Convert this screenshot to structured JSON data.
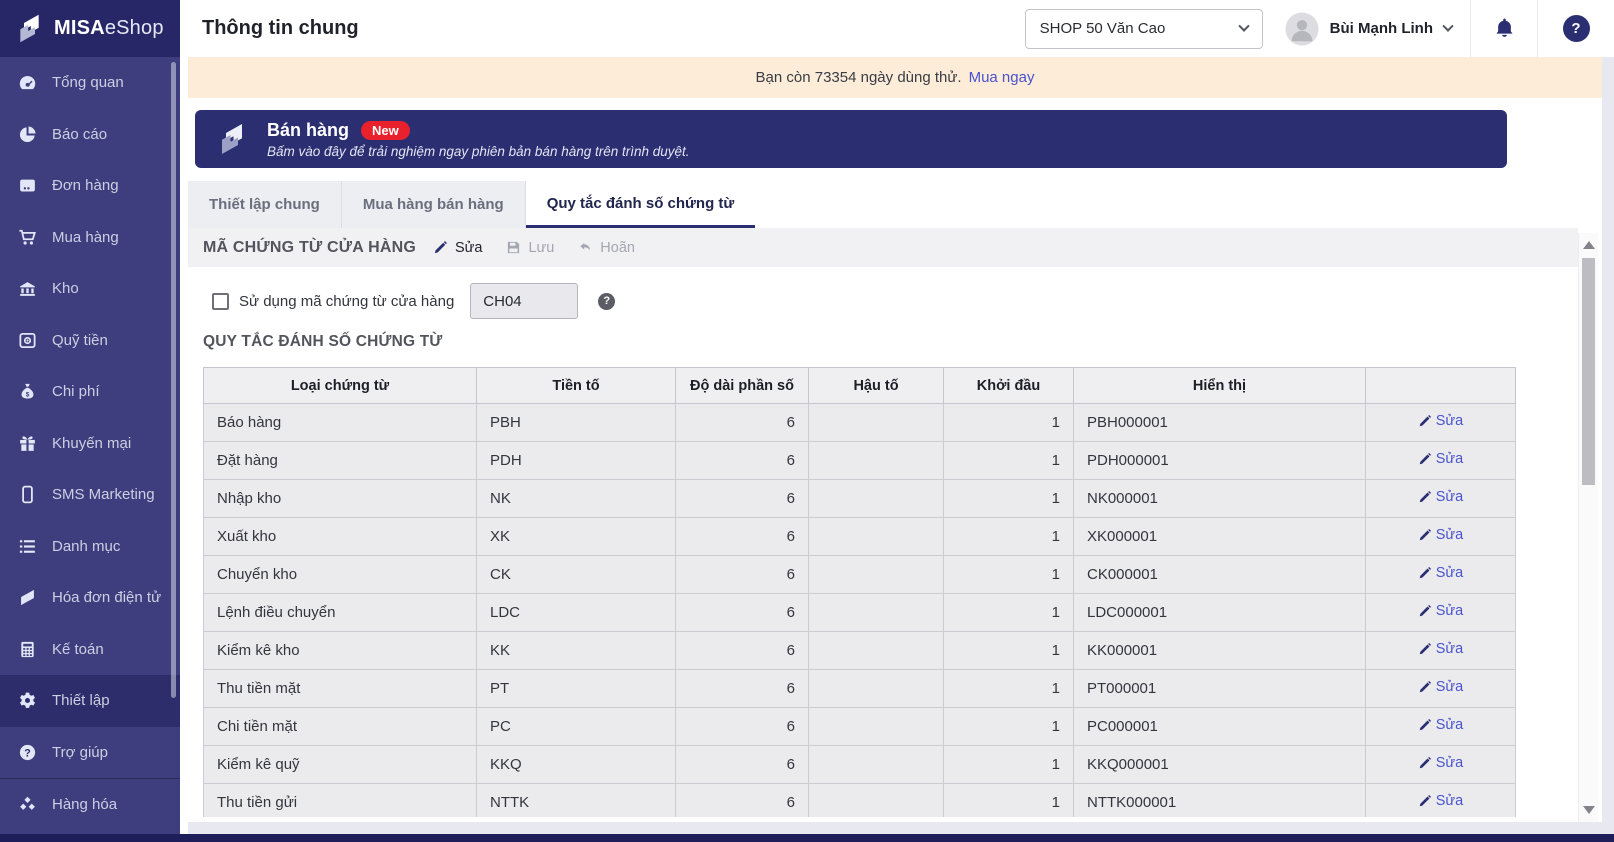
{
  "colors": {
    "accent_navy": "#2b2f72",
    "sidebar_bg": "#3e3e7e",
    "sidebar_header_bg": "#272768",
    "badge_red": "#e8212d",
    "link_blue": "#4a53cd",
    "trial_bg": "#fcecd8"
  },
  "brand": {
    "name_bold": "MISA",
    "name_rest": "eShop"
  },
  "sidebar": {
    "items": [
      {
        "id": "tong-quan",
        "icon": "dashboard",
        "label": "Tổng quan",
        "active": false
      },
      {
        "id": "bao-cao",
        "icon": "pie-chart",
        "label": "Báo cáo",
        "active": false
      },
      {
        "id": "don-hang",
        "icon": "orders",
        "label": "Đơn hàng",
        "active": false
      },
      {
        "id": "mua-hang",
        "icon": "cart",
        "label": "Mua hàng",
        "active": false
      },
      {
        "id": "kho",
        "icon": "warehouse",
        "label": "Kho",
        "active": false
      },
      {
        "id": "quy-tien",
        "icon": "safe",
        "label": "Quỹ tiền",
        "active": false
      },
      {
        "id": "chi-phi",
        "icon": "money-bag",
        "label": "Chi phí",
        "active": false
      },
      {
        "id": "khuyen-mai",
        "icon": "gift",
        "label": "Khuyến mại",
        "active": false
      },
      {
        "id": "sms-marketing",
        "icon": "phone",
        "label": "SMS Marketing",
        "active": false
      },
      {
        "id": "danh-muc",
        "icon": "list",
        "label": "Danh mục",
        "active": false
      },
      {
        "id": "hoa-don-dien-tu",
        "icon": "e-invoice",
        "label": "Hóa đơn điện tử",
        "active": false
      },
      {
        "id": "ke-toan",
        "icon": "calculator",
        "label": "Kế toán",
        "active": false
      },
      {
        "id": "thiet-lap",
        "icon": "gear",
        "label": "Thiết lập",
        "active": true
      },
      {
        "id": "tro-giup",
        "icon": "help",
        "label": "Trợ giúp",
        "active": false
      },
      {
        "id": "hang-hoa",
        "icon": "goods",
        "label": "Hàng hóa",
        "active": false,
        "separator": true
      }
    ]
  },
  "header": {
    "title": "Thông tin chung",
    "shop_selector_value": "SHOP 50 Văn Cao",
    "user_name": "Bùi Mạnh Linh",
    "help_glyph": "?"
  },
  "trial_bar": {
    "message": "Bạn còn 73354 ngày dùng thử.",
    "link_label": "Mua ngay"
  },
  "promo_banner": {
    "title": "Bán hàng",
    "badge": "New",
    "subtitle": "Bấm vào đây để trải nghiệm ngay phiên bản bán hàng trên trình duyệt."
  },
  "tabs": [
    {
      "label": "Thiết lập chung",
      "active": false
    },
    {
      "label": "Mua hàng bán hàng",
      "active": false
    },
    {
      "label": "Quy tắc đánh số chứng từ",
      "active": true
    }
  ],
  "store_code_section": {
    "title": "MÃ CHỨNG TỪ CỬA HÀNG",
    "edit_label": "Sửa",
    "save_label": "Lưu",
    "undo_label": "Hoãn",
    "checkbox_label": "Sử dụng mã chứng từ cửa hàng",
    "checkbox_checked": false,
    "store_code_value": "CH04"
  },
  "numbering_section": {
    "title": "QUY TẮC ĐÁNH SỐ CHỨNG TỪ",
    "columns": [
      "Loại chứng từ",
      "Tiền tố",
      "Độ dài phần số",
      "Hậu tố",
      "Khởi đầu",
      "Hiển thị",
      ""
    ],
    "row_edit_label": "Sửa",
    "rows": [
      {
        "type": "Báo hàng",
        "prefix": "PBH",
        "length": "6",
        "suffix": "",
        "start": "1",
        "display": "PBH000001"
      },
      {
        "type": "Đặt hàng",
        "prefix": "PDH",
        "length": "6",
        "suffix": "",
        "start": "1",
        "display": "PDH000001"
      },
      {
        "type": "Nhập kho",
        "prefix": "NK",
        "length": "6",
        "suffix": "",
        "start": "1",
        "display": "NK000001"
      },
      {
        "type": "Xuất kho",
        "prefix": "XK",
        "length": "6",
        "suffix": "",
        "start": "1",
        "display": "XK000001"
      },
      {
        "type": "Chuyển kho",
        "prefix": "CK",
        "length": "6",
        "suffix": "",
        "start": "1",
        "display": "CK000001"
      },
      {
        "type": "Lệnh điều chuyển",
        "prefix": "LDC",
        "length": "6",
        "suffix": "",
        "start": "1",
        "display": "LDC000001"
      },
      {
        "type": "Kiểm kê kho",
        "prefix": "KK",
        "length": "6",
        "suffix": "",
        "start": "1",
        "display": "KK000001"
      },
      {
        "type": "Thu tiền mặt",
        "prefix": "PT",
        "length": "6",
        "suffix": "",
        "start": "1",
        "display": "PT000001"
      },
      {
        "type": "Chi tiền mặt",
        "prefix": "PC",
        "length": "6",
        "suffix": "",
        "start": "1",
        "display": "PC000001"
      },
      {
        "type": "Kiểm kê quỹ",
        "prefix": "KKQ",
        "length": "6",
        "suffix": "",
        "start": "1",
        "display": "KKQ000001"
      },
      {
        "type": "Thu tiền gửi",
        "prefix": "NTTK",
        "length": "6",
        "suffix": "",
        "start": "1",
        "display": "NTTK000001"
      }
    ]
  }
}
